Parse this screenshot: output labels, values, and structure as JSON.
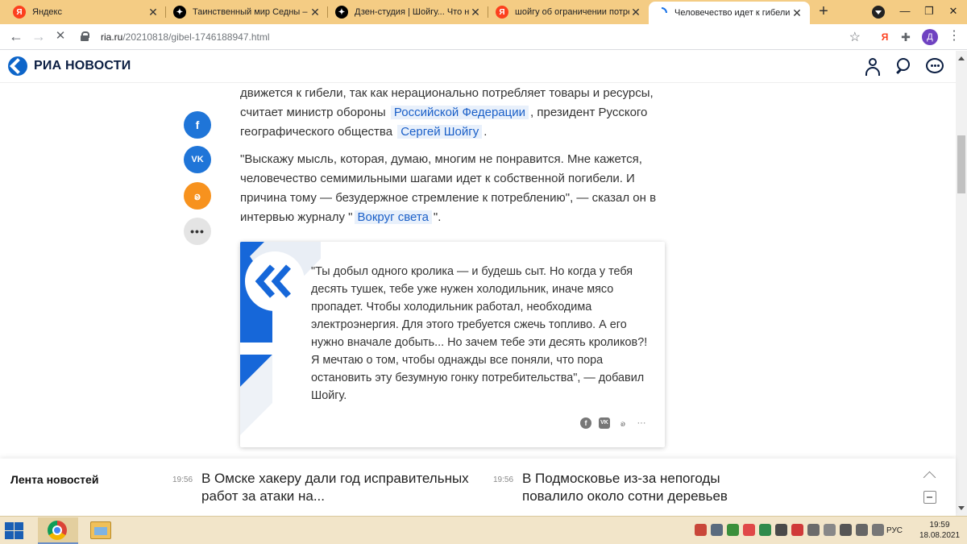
{
  "browser": {
    "tabs": [
      {
        "title": "Яндекс",
        "favicon": "yandex-icon"
      },
      {
        "title": "Таинственный мир Седны – с",
        "favicon": "zen-icon"
      },
      {
        "title": "Дзен-студия | Шойгу... Что на",
        "favicon": "zen-icon"
      },
      {
        "title": "шойгу об ограничении потре",
        "favicon": "yandex-icon"
      },
      {
        "title": "Человечество идет к гибели",
        "favicon": "ria-icon",
        "active": true
      }
    ],
    "url_host": "ria.ru",
    "url_path": "/20210818/gibel-1746188947.html",
    "profile_initial": "Д",
    "yandex_ext": "Я"
  },
  "site": {
    "logo_text": "РИА НОВОСТИ",
    "brand_color": "#0d65c9"
  },
  "article": {
    "p1": {
      "a": "движется к гибели, так как нерационально потребляет товары и ресурсы, считает министр обороны",
      "link1": "Российской Федерации",
      "b": ", президент Русского географического общества",
      "link2": "Сергей Шойгу",
      "c": "."
    },
    "p2": {
      "a": "\"Выскажу мысль, которая, думаю, многим не понравится. Мне кажется, человечество семимильными шагами идет к собственной погибели. И причина тому — безудержное стремление к потреблению\", — сказал он в интервью журналу \"",
      "link": "Вокруг света",
      "b": "\"."
    },
    "quote": "\"Ты добыл одного кролика — и будешь сыт. Но когда у тебя десять тушек, тебе уже нужен холодильник, иначе мясо пропадет. Чтобы холодильник работал, необходима электроэнергия. Для этого требуется сжечь топливо. А его нужно вначале добыть... Но зачем тебе эти десять кроликов?! Я мечтаю о том, чтобы однажды все поняли, что пора остановить эту безумную гонку потребительства\", — добавил Шойгу."
  },
  "share_buttons": [
    "facebook-icon",
    "vk-icon",
    "odnoklassniki-icon",
    "more-icon"
  ],
  "ticker": {
    "title": "Лента новостей",
    "items": [
      {
        "time": "19:56",
        "text": "В Омске хакеру дали год исправительных работ за атаки на..."
      },
      {
        "time": "19:56",
        "text": "В Подмосковье из-за непогоды повалило около сотни деревьев"
      }
    ]
  },
  "taskbar": {
    "lang": "РУС",
    "time": "19:59",
    "date": "18.08.2021"
  }
}
